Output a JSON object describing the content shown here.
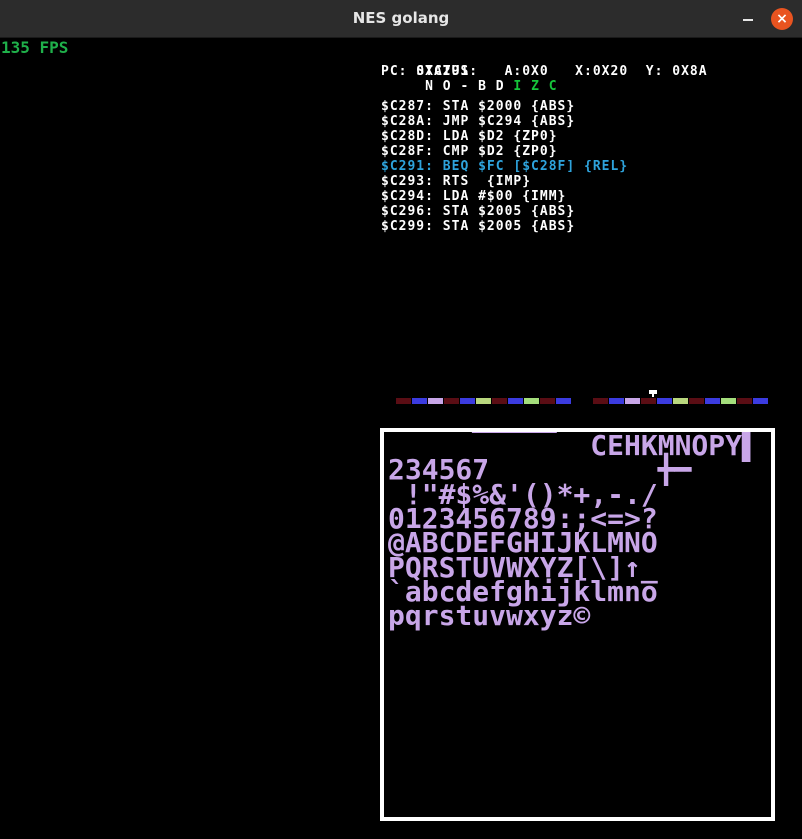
{
  "window": {
    "title": "NES golang",
    "minimize_glyph": "",
    "close_glyph": "×"
  },
  "fps": "135 FPS",
  "cpu": {
    "status_label": "STATUS:",
    "flags": [
      {
        "letter": "N",
        "on": false
      },
      {
        "letter": "O",
        "on": false
      },
      {
        "letter": "-",
        "on": false
      },
      {
        "letter": "B",
        "on": false
      },
      {
        "letter": "D",
        "on": false
      },
      {
        "letter": "I",
        "on": true
      },
      {
        "letter": "Z",
        "on": true
      },
      {
        "letter": "C",
        "on": true
      }
    ],
    "pc_line": "PC: 0XC291    A:0X0   X:0X20  Y: 0X8A"
  },
  "disassembly": [
    {
      "text": "$C287: STA $2000 {ABS}",
      "current": false
    },
    {
      "text": "$C28A: JMP $C294 {ABS}",
      "current": false
    },
    {
      "text": "$C28D: LDA $D2 {ZP0}",
      "current": false
    },
    {
      "text": "$C28F: CMP $D2 {ZP0}",
      "current": false
    },
    {
      "text": "$C291: BEQ $FC [$C28F] {REL}",
      "current": true
    },
    {
      "text": "$C293: RTS  {IMP}",
      "current": false
    },
    {
      "text": "$C294: LDA #$00 {IMM}",
      "current": false
    },
    {
      "text": "$C296: STA $2005 {ABS}",
      "current": false
    },
    {
      "text": "$C299: STA $2005 {ABS}",
      "current": false
    }
  ],
  "palette": {
    "colors": [
      "#5a0d14",
      "#3b3be0",
      "#c8a6e8",
      "#5a0d14",
      "#3b3be0",
      "#b9d77e",
      "#5a0d14",
      "#3b3be0",
      "#a4de7c",
      "#5a0d14",
      "#3b3be0"
    ],
    "selected_index": 7
  },
  "pattern_table": {
    "rows": [
      "     ▔▔▔▔▔  CEHKMNOPY▌",
      "234567          ╋━",
      " !\"#$%&'()*+,-./",
      "0123456789:;<=>?",
      "@ABCDEFGHIJKLMNO",
      "PQRSTUVWXYZ[\\]↑_",
      "`abcdefghijklmno",
      "pqrstuvwxyz©"
    ]
  }
}
